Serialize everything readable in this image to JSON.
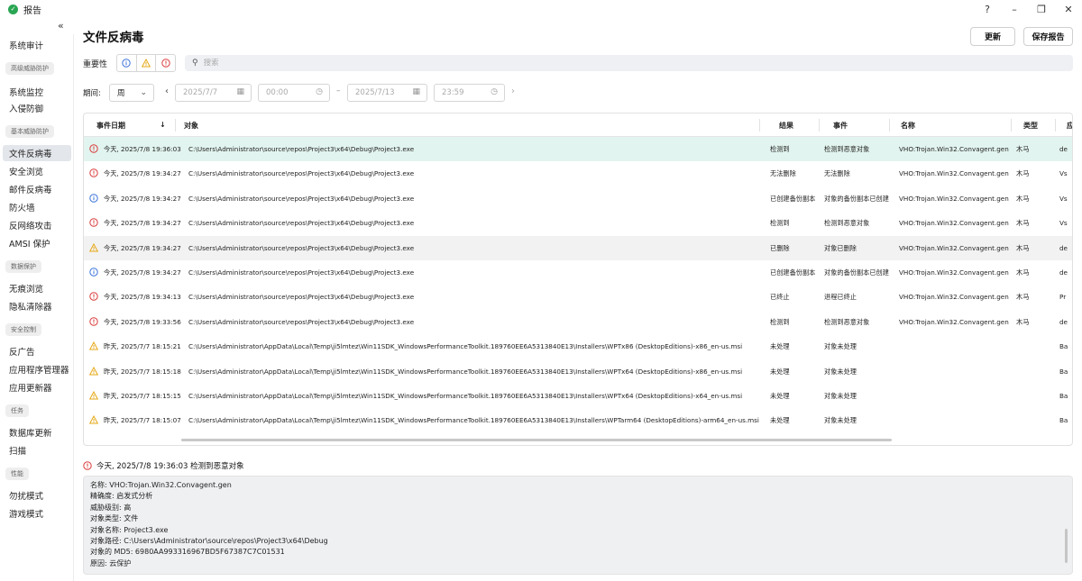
{
  "window": {
    "title": "报告",
    "controls": [
      "?",
      "–",
      "❐",
      "✕"
    ]
  },
  "sidebar": {
    "collapse_icon": "«",
    "items": [
      {
        "type": "item",
        "label": "系统审计"
      },
      {
        "type": "group",
        "label": "高级威胁防护"
      },
      {
        "type": "item",
        "label": "系统监控"
      },
      {
        "type": "item",
        "label": "入侵防御"
      },
      {
        "type": "group",
        "label": "基本威胁防护"
      },
      {
        "type": "item",
        "label": "文件反病毒",
        "active": true
      },
      {
        "type": "item",
        "label": "安全浏览"
      },
      {
        "type": "item",
        "label": "邮件反病毒"
      },
      {
        "type": "item",
        "label": "防火墙"
      },
      {
        "type": "item",
        "label": "反网络攻击"
      },
      {
        "type": "item",
        "label": "AMSI 保护"
      },
      {
        "type": "group",
        "label": "数据保护"
      },
      {
        "type": "item",
        "label": "无痕浏览"
      },
      {
        "type": "item",
        "label": "隐私清除器"
      },
      {
        "type": "group",
        "label": "安全控制"
      },
      {
        "type": "item",
        "label": "反广告"
      },
      {
        "type": "item",
        "label": "应用程序管理器"
      },
      {
        "type": "item",
        "label": "应用更新器"
      },
      {
        "type": "group",
        "label": "任务"
      },
      {
        "type": "item",
        "label": "数据库更新"
      },
      {
        "type": "item",
        "label": "扫描"
      },
      {
        "type": "group",
        "label": "性能"
      },
      {
        "type": "item",
        "label": "勿扰模式"
      },
      {
        "type": "item",
        "label": "游戏模式"
      }
    ]
  },
  "header": {
    "title": "文件反病毒",
    "update_button": "更新",
    "save_button": "保存报告"
  },
  "filters": {
    "severity_label": "重要性",
    "search_placeholder": "搜索",
    "period_label": "期间:",
    "period_value": "周",
    "date_from": "2025/7/7",
    "time_from": "00:00",
    "date_to": "2025/7/13",
    "time_to": "23:59",
    "separator": "–"
  },
  "colors": {
    "info": "#3b73d9",
    "warning": "#e6a817",
    "danger": "#d93b3b",
    "selected_row": "#e2f4ef"
  },
  "table": {
    "columns": [
      "事件日期",
      "对象",
      "结果",
      "事件",
      "名称",
      "类型",
      "应"
    ],
    "sort_indicator": "↓",
    "rows": [
      {
        "sev": "danger",
        "date": "今天, 2025/7/8 19:36:03",
        "object": "C:\\Users\\Administrator\\source\\repos\\Project3\\x64\\Debug\\Project3.exe",
        "result": "检测到",
        "event": "检测到恶意对象",
        "name": "VHO:Trojan.Win32.Convagent.gen",
        "type": "木马",
        "app": "de"
      },
      {
        "sev": "danger",
        "date": "今天, 2025/7/8 19:34:27",
        "object": "C:\\Users\\Administrator\\source\\repos\\Project3\\x64\\Debug\\Project3.exe",
        "result": "无法删除",
        "event": "无法删除",
        "name": "VHO:Trojan.Win32.Convagent.gen",
        "type": "木马",
        "app": "Vs"
      },
      {
        "sev": "info",
        "date": "今天, 2025/7/8 19:34:27",
        "object": "C:\\Users\\Administrator\\source\\repos\\Project3\\x64\\Debug\\Project3.exe",
        "result": "已创建备份副本",
        "event": "对象的备份副本已创建",
        "name": "VHO:Trojan.Win32.Convagent.gen",
        "type": "木马",
        "app": "Vs"
      },
      {
        "sev": "danger",
        "date": "今天, 2025/7/8 19:34:27",
        "object": "C:\\Users\\Administrator\\source\\repos\\Project3\\x64\\Debug\\Project3.exe",
        "result": "检测到",
        "event": "检测到恶意对象",
        "name": "VHO:Trojan.Win32.Convagent.gen",
        "type": "木马",
        "app": "Vs"
      },
      {
        "sev": "warning",
        "date": "今天, 2025/7/8 19:34:27",
        "object": "C:\\Users\\Administrator\\source\\repos\\Project3\\x64\\Debug\\Project3.exe",
        "result": "已删除",
        "event": "对象已删除",
        "name": "VHO:Trojan.Win32.Convagent.gen",
        "type": "木马",
        "app": "de"
      },
      {
        "sev": "info",
        "date": "今天, 2025/7/8 19:34:27",
        "object": "C:\\Users\\Administrator\\source\\repos\\Project3\\x64\\Debug\\Project3.exe",
        "result": "已创建备份副本",
        "event": "对象的备份副本已创建",
        "name": "VHO:Trojan.Win32.Convagent.gen",
        "type": "木马",
        "app": "de"
      },
      {
        "sev": "danger",
        "date": "今天, 2025/7/8 19:34:13",
        "object": "C:\\Users\\Administrator\\source\\repos\\Project3\\x64\\Debug\\Project3.exe",
        "result": "已终止",
        "event": "进程已终止",
        "name": "VHO:Trojan.Win32.Convagent.gen",
        "type": "木马",
        "app": "Pr"
      },
      {
        "sev": "danger",
        "date": "今天, 2025/7/8 19:33:56",
        "object": "C:\\Users\\Administrator\\source\\repos\\Project3\\x64\\Debug\\Project3.exe",
        "result": "检测到",
        "event": "检测到恶意对象",
        "name": "VHO:Trojan.Win32.Convagent.gen",
        "type": "木马",
        "app": "de"
      },
      {
        "sev": "warning",
        "date": "昨天, 2025/7/7 18:15:21",
        "object": "C:\\Users\\Administrator\\AppData\\Local\\Temp\\ji5lmtez\\Win11SDK_WindowsPerformanceToolkit.189760EE6A5313840E13\\Installers\\WPTx86 (DesktopEditions)-x86_en-us.msi",
        "result": "未处理",
        "event": "对象未处理",
        "name": "",
        "type": "",
        "app": "Ba"
      },
      {
        "sev": "warning",
        "date": "昨天, 2025/7/7 18:15:18",
        "object": "C:\\Users\\Administrator\\AppData\\Local\\Temp\\ji5lmtez\\Win11SDK_WindowsPerformanceToolkit.189760EE6A5313840E13\\Installers\\WPTx64 (DesktopEditions)-x86_en-us.msi",
        "result": "未处理",
        "event": "对象未处理",
        "name": "",
        "type": "",
        "app": "Ba"
      },
      {
        "sev": "warning",
        "date": "昨天, 2025/7/7 18:15:15",
        "object": "C:\\Users\\Administrator\\AppData\\Local\\Temp\\ji5lmtez\\Win11SDK_WindowsPerformanceToolkit.189760EE6A5313840E13\\Installers\\WPTx64 (DesktopEditions)-x64_en-us.msi",
        "result": "未处理",
        "event": "对象未处理",
        "name": "",
        "type": "",
        "app": "Ba"
      },
      {
        "sev": "warning",
        "date": "昨天, 2025/7/7 18:15:07",
        "object": "C:\\Users\\Administrator\\AppData\\Local\\Temp\\ji5lmtez\\Win11SDK_WindowsPerformanceToolkit.189760EE6A5313840E13\\Installers\\WPTarm64 (DesktopEditions)-arm64_en-us.msi",
        "result": "未处理",
        "event": "对象未处理",
        "name": "",
        "type": "",
        "app": "Ba"
      }
    ]
  },
  "detail": {
    "header": "今天, 2025/7/8 19:36:03 检测到恶意对象",
    "lines": [
      "名称: VHO:Trojan.Win32.Convagent.gen",
      "精确度: 启发式分析",
      "威胁级别: 高",
      "对象类型: 文件",
      "对象名称: Project3.exe",
      "对象路径: C:\\Users\\Administrator\\source\\repos\\Project3\\x64\\Debug",
      "对象的 MD5: 6980AA993316967BD5F67387C7C01531",
      "原因: 云保护"
    ]
  }
}
